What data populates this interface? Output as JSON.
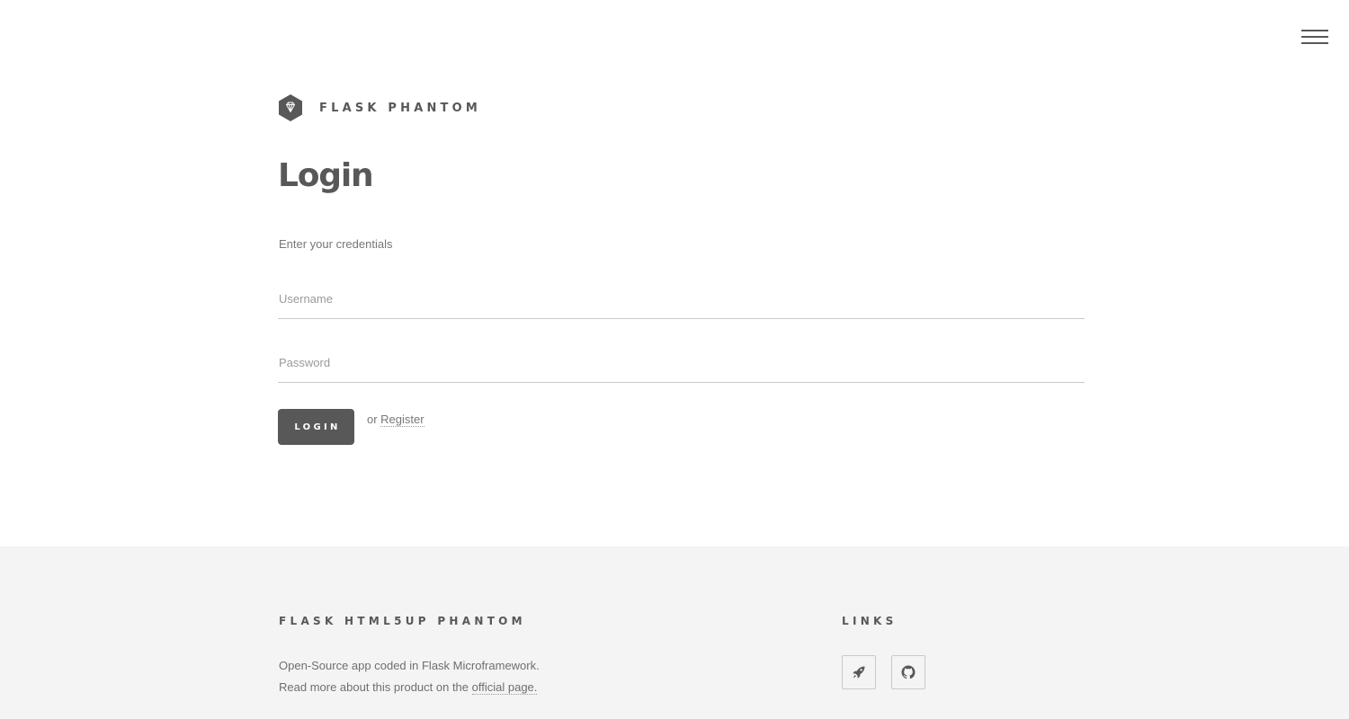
{
  "header": {
    "brand": "FLASK PHANTOM",
    "logo_icon": "diamond-hexagon-icon",
    "menu_icon": "hamburger-menu-icon"
  },
  "main": {
    "title": "Login",
    "subtitle": "Enter your credentials",
    "username_placeholder": "Username",
    "password_placeholder": "Password",
    "login_label": "LOGIN",
    "or_text": "or ",
    "register_label": "Register"
  },
  "footer": {
    "about_heading": "FLASK HTML5UP PHANTOM",
    "about_line1": "Open-Source app coded in Flask Microframework.",
    "about_line2_prefix": "Read more about this product on the ",
    "about_link": "official page.",
    "links_heading": "LINKS",
    "links": [
      {
        "icon": "rocket-icon"
      },
      {
        "icon": "github-icon"
      }
    ]
  },
  "colors": {
    "text": "#585858",
    "button_bg": "#585858",
    "footer_bg": "#f4f4f4",
    "border": "#c9c9c9"
  }
}
